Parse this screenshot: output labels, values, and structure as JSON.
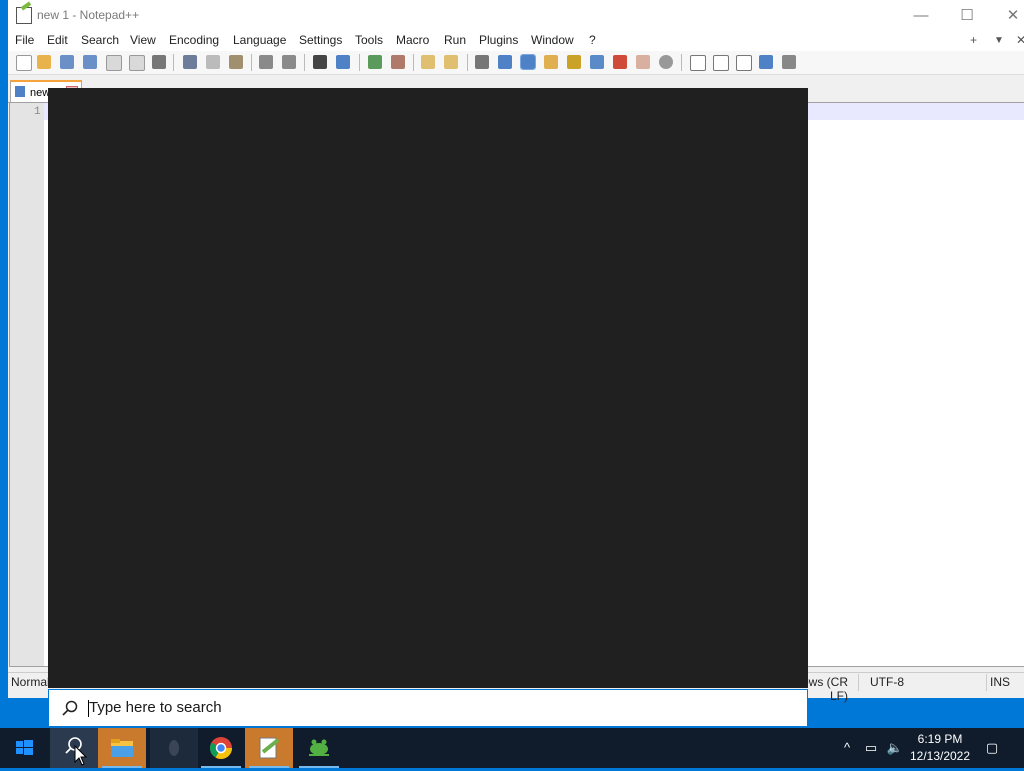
{
  "window": {
    "title": "new 1 - Notepad++",
    "minimize": "—",
    "maximize": "☐",
    "close": "✕"
  },
  "menu": [
    "File",
    "Edit",
    "Search",
    "View",
    "Encoding",
    "Language",
    "Settings",
    "Tools",
    "Macro",
    "Run",
    "Plugins",
    "Window",
    "?"
  ],
  "menu_right": {
    "add": "+",
    "dropdown": "▼",
    "close": "✕"
  },
  "tab": {
    "label": "new 1"
  },
  "editor": {
    "line_number": "1"
  },
  "status": {
    "mode": "Normal",
    "eol": "Windows (CR LF)",
    "encoding": "UTF-8",
    "ins": "INS"
  },
  "search": {
    "placeholder": "Type here to search"
  },
  "taskbar": {
    "time": "6:19 PM",
    "date": "12/13/2022",
    "apps": [
      "start",
      "search",
      "file-explorer",
      "app-dark",
      "chrome",
      "notepad-plus-plus",
      "frog-app"
    ]
  },
  "colors": {
    "accent": "#0078d7",
    "taskbar": "#101c2b",
    "search_panel": "#202020"
  }
}
